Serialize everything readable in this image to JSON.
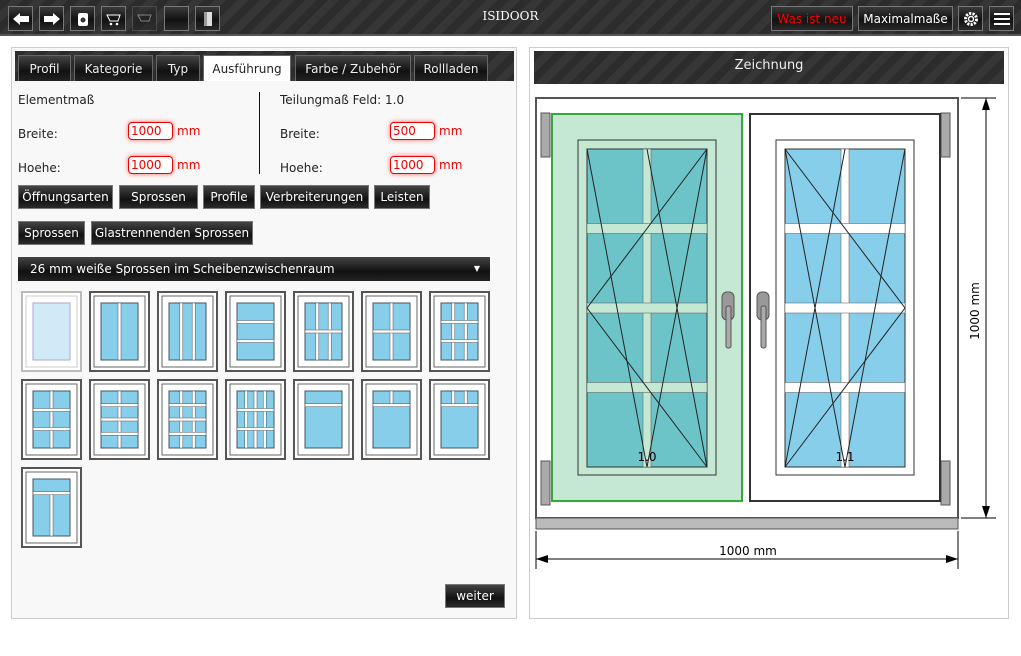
{
  "app": {
    "title": "ISIDOOR"
  },
  "toolbar": {
    "left_icons": [
      "arrow-left-icon",
      "arrow-right-icon",
      "trash-icon",
      "cart-add-icon",
      "cart-disabled-icon",
      "blank-icon",
      "door-icon"
    ],
    "whats_new": "Was ist neu",
    "max_dims": "Maximalmaße",
    "settings_icon": "gear-icon",
    "menu_icon": "hamburger-icon"
  },
  "tabs": [
    {
      "label": "Profil"
    },
    {
      "label": "Kategorie"
    },
    {
      "label": "Typ"
    },
    {
      "label": "Ausführung",
      "active": true
    },
    {
      "label": "Farbe / Zubehör"
    },
    {
      "label": "Rollladen"
    }
  ],
  "element": {
    "heading": "Elementmaß",
    "width_label": "Breite:",
    "width": "1000",
    "height_label": "Hoehe:",
    "height": "1000",
    "unit": "mm"
  },
  "field": {
    "heading": "Teilungmaß Feld: 1.0",
    "width_label": "Breite:",
    "width": "500",
    "height_label": "Hoehe:",
    "height": "1000",
    "unit": "mm"
  },
  "buttons_row1": [
    "Öffnungsarten",
    "Sprossen",
    "Profile",
    "Verbreiterungen",
    "Leisten"
  ],
  "buttons_row2": [
    "Sprossen",
    "Glastrennenden Sprossen"
  ],
  "dropdown": {
    "selected": "26 mm weiße Sprossen im Scheibenzwischenraum"
  },
  "muntin_options": [
    {
      "v": [],
      "h": [],
      "selected": true
    },
    {
      "v": [
        0.5
      ],
      "h": []
    },
    {
      "v": [
        0.333,
        0.667
      ],
      "h": []
    },
    {
      "v": [],
      "h": [
        0.333,
        0.667
      ]
    },
    {
      "v": [
        0.333,
        0.667
      ],
      "h": [
        0.5
      ]
    },
    {
      "v": [
        0.5
      ],
      "h": [
        0.5
      ]
    },
    {
      "v": [
        0.333,
        0.667
      ],
      "h": [
        0.333,
        0.667
      ]
    },
    {
      "v": [
        0.5
      ],
      "h": [
        0.333,
        0.667
      ]
    },
    {
      "v": [
        0.5
      ],
      "h": [
        0.25,
        0.5,
        0.75
      ]
    },
    {
      "v": [
        0.333,
        0.667
      ],
      "h": [
        0.25,
        0.5,
        0.75
      ]
    },
    {
      "v": [
        0.25,
        0.5,
        0.75
      ],
      "h": [
        0.333,
        0.667
      ]
    },
    {
      "v": [],
      "h": [
        0.25
      ]
    },
    {
      "v": [
        0.5
      ],
      "h": [
        0.25
      ],
      "v_region": "top"
    },
    {
      "v": [
        0.333,
        0.667
      ],
      "h": [
        0.25
      ],
      "v_region": "top"
    },
    {
      "v": [
        0.5
      ],
      "h": [
        0.25
      ],
      "v_region": "bottom"
    }
  ],
  "next_button": "weiter",
  "drawing": {
    "heading": "Zeichnung",
    "sash_labels": [
      "1.0",
      "1.1"
    ],
    "width_dim": "1000 mm",
    "height_dim": "1000 mm",
    "selected_sash_color": "#c5e8d5",
    "glass_color": "#87ceeb"
  }
}
